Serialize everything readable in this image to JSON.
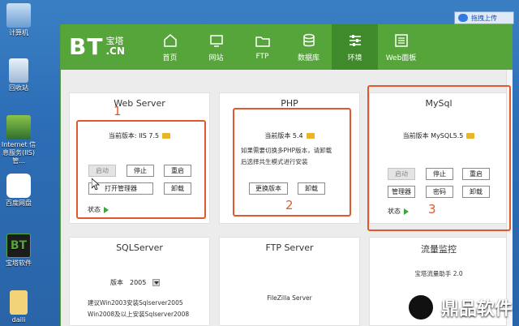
{
  "desktop": {
    "icons": [
      {
        "label": "计算机"
      },
      {
        "label": "回收站"
      },
      {
        "label": "Internet 信\n息服务(IIS)管..."
      },
      {
        "label": "百度网盘"
      },
      {
        "label": "宝塔软件"
      },
      {
        "label": "daili"
      }
    ],
    "drag_upload": "拖拽上传"
  },
  "app": {
    "logo": {
      "text": "BT",
      "cn1": "宝塔",
      "cn2": ".CN"
    },
    "nav": [
      {
        "label": "首页",
        "icon": "home-icon"
      },
      {
        "label": "网站",
        "icon": "website-icon"
      },
      {
        "label": "FTP",
        "icon": "folder-icon"
      },
      {
        "label": "数据库",
        "icon": "database-icon"
      },
      {
        "label": "环境",
        "icon": "settings-sliders-icon"
      },
      {
        "label": "Web面板",
        "icon": "web-panel-icon"
      }
    ],
    "cards": {
      "web": {
        "title": "Web Server",
        "version": "当前版本: IIS 7.5",
        "buttons": [
          "启动",
          "停止",
          "重启",
          "打开管理器",
          "卸载"
        ],
        "status": "状态"
      },
      "php": {
        "title": "PHP",
        "version": "当前版本 5.4",
        "desc1": "如果需要切换多PHP版本，请卸载",
        "desc2": "后选择共生模式进行安装",
        "buttons": [
          "更换版本",
          "卸载"
        ]
      },
      "mysql": {
        "title": "MySql",
        "version": "当前版本 MySQL5.5",
        "buttons": [
          "启动",
          "停止",
          "重启",
          "管理器",
          "密码",
          "卸载"
        ],
        "status": "状态"
      },
      "sql": {
        "title": "SQLServer",
        "ver_label": "版本",
        "ver_value": "2005",
        "tip1": "建议Win2003安装Sqlserver2005",
        "tip2": "Win2008及以上安装Sqlserver2008"
      },
      "ftp": {
        "title": "FTP Server",
        "text": "FileZilla Server"
      },
      "flow": {
        "title": "流量监控",
        "text": "宝塔流量助手 2.0"
      }
    },
    "annotations": [
      "1",
      "2",
      "3"
    ]
  },
  "watermark": {
    "text": "鼎品软件"
  },
  "colors": {
    "green": "#56a53a",
    "annotation": "#e2582e"
  }
}
